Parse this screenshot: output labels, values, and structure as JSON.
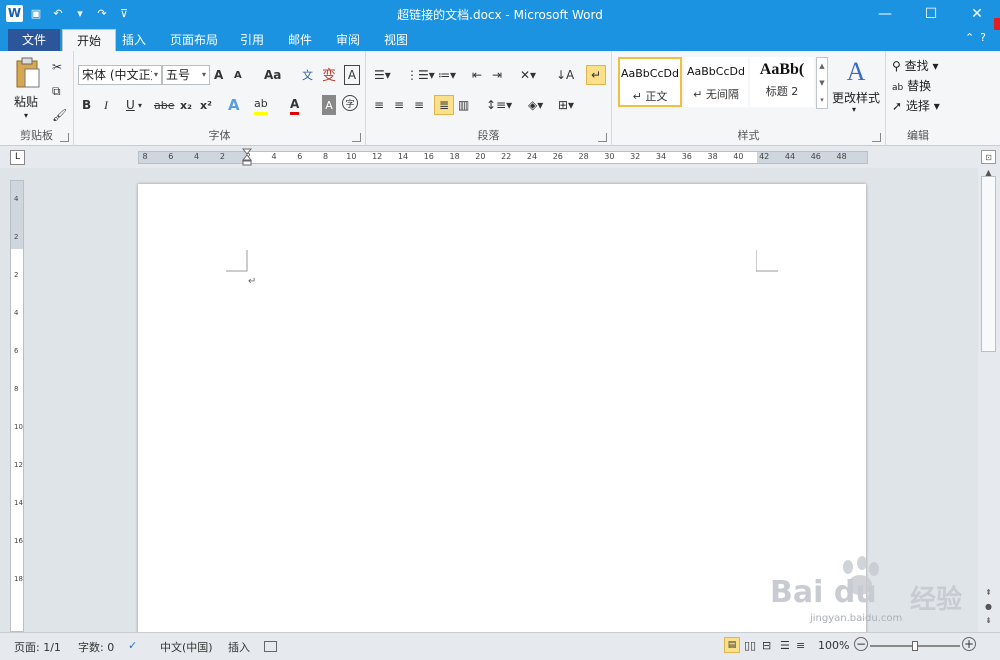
{
  "window": {
    "title": "超链接的文档.docx - Microsoft Word",
    "minimize_icon": "—",
    "maximize_icon": "☐",
    "close_icon": "✕"
  },
  "quick_access": {
    "logo": "W",
    "save_icon": "▣",
    "undo_icon": "↶",
    "redo_icon": "↷",
    "customize_icon": "▾"
  },
  "tabs": [
    {
      "label": "文件"
    },
    {
      "label": "开始"
    },
    {
      "label": "插入"
    },
    {
      "label": "页面布局"
    },
    {
      "label": "引用"
    },
    {
      "label": "邮件"
    },
    {
      "label": "审阅"
    },
    {
      "label": "视图"
    }
  ],
  "ribbon": {
    "clipboard": {
      "label": "剪贴板",
      "paste": "粘贴"
    },
    "font": {
      "label": "字体",
      "font_name": "宋体 (中文正文)",
      "font_size": "五号",
      "grow": "A",
      "shrink": "A",
      "change_case": "Aa",
      "bold": "B",
      "italic": "I",
      "underline": "U",
      "strike": "abe",
      "subscript": "x₂",
      "superscript": "x²",
      "text_effects": "A",
      "highlight": "ab",
      "font_color": "A",
      "char_shading": "A",
      "enclose": "字",
      "phonetic": "文",
      "char_border": "A"
    },
    "paragraph": {
      "label": "段落"
    },
    "styles": {
      "label": "样式",
      "items": [
        {
          "sample": "AaBbCcDd",
          "name": "↵ 正文"
        },
        {
          "sample": "AaBbCcDd",
          "name": "↵ 无间隔"
        },
        {
          "sample": "AaBb(",
          "name": "标题 2"
        }
      ],
      "change_styles": "更改样式"
    },
    "editing": {
      "label": "编辑",
      "find": "查找",
      "replace": "替换",
      "select": "选择"
    }
  },
  "ruler": {
    "numbers": [
      "8",
      "6",
      "4",
      "2",
      "2",
      "4",
      "6",
      "8",
      "10",
      "12",
      "14",
      "16",
      "18",
      "20",
      "22",
      "24",
      "26",
      "28",
      "30",
      "32",
      "34",
      "36",
      "38",
      "40",
      "42",
      "44",
      "46",
      "48"
    ],
    "corner": "L"
  },
  "vruler": {
    "numbers": [
      "4",
      "2",
      "2",
      "4",
      "6",
      "8",
      "10",
      "12",
      "14",
      "16",
      "18"
    ]
  },
  "document": {
    "paragraph_mark": "↵"
  },
  "statusbar": {
    "page": "页面: 1/1",
    "words": "字数: 0",
    "language": "中文(中国)",
    "insert_mode": "插入",
    "zoom": "100%",
    "zoom_level": 0.5
  },
  "watermark": {
    "brand": "Bai du",
    "brand_cn": "经验",
    "url": "jingyan.baidu.com"
  }
}
